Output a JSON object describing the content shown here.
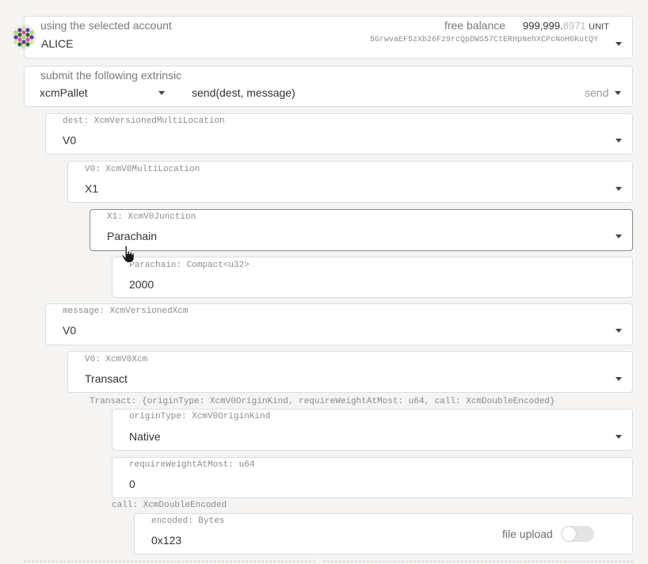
{
  "account": {
    "label": "using the selected account",
    "name": "ALICE",
    "free_balance_label": "free balance",
    "balance_main": "999,999.",
    "balance_decimal": "8971",
    "balance_unit": "UNIT",
    "address": "5GrwvaEF5zXb26Fz9rcQpDWS57CtERHpNehXCPcNoHGKutQY"
  },
  "extrinsic": {
    "label": "submit the following extrinsic",
    "pallet": "xcmPallet",
    "call_signature": "send(dest, message)",
    "method": "send"
  },
  "dest": {
    "label": "dest: XcmVersionedMultiLocation",
    "value": "V0"
  },
  "dest_v0": {
    "label": "V0: XcmV0MultiLocation",
    "value": "X1"
  },
  "dest_x1": {
    "label": "X1: XcmV0Junction",
    "value": "Parachain"
  },
  "parachain": {
    "label": "Parachain: Compact<u32>",
    "value": "2000"
  },
  "message": {
    "label": "message: XcmVersionedXcm",
    "value": "V0"
  },
  "message_v0": {
    "label": "V0: XcmV0Xcm",
    "value": "Transact"
  },
  "transact": {
    "label": "Transact: {originType: XcmV0OriginKind, requireWeightAtMost: u64, call: XcmDoubleEncoded}"
  },
  "origin_type": {
    "label": "originType: XcmV0OriginKind",
    "value": "Native"
  },
  "require_weight": {
    "label": "requireWeightAtMost: u64",
    "value": "0"
  },
  "call": {
    "label": "call: XcmDoubleEncoded"
  },
  "encoded": {
    "label": "encoded: Bytes",
    "value": "0x123",
    "file_upload_label": "file upload",
    "file_upload_on": false
  }
}
